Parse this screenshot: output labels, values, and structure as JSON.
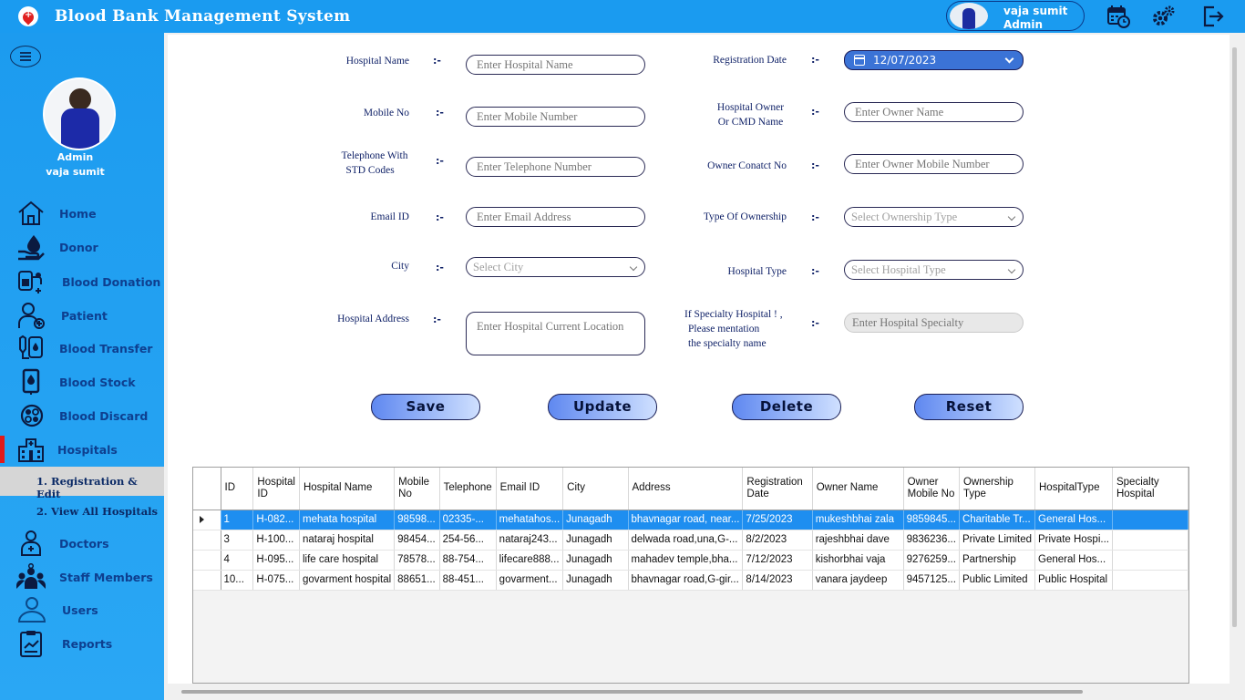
{
  "app": {
    "title": "Blood Bank Management System"
  },
  "header": {
    "user_name": "vaja sumit",
    "user_role": "Admin",
    "icons": [
      "calendar-clock-icon",
      "settings-gear-icon",
      "logout-icon"
    ]
  },
  "sidebar": {
    "profile_role": "Admin",
    "profile_name": "vaja sumit",
    "items": [
      {
        "label": "Home",
        "icon": "home-icon"
      },
      {
        "label": "Donor",
        "icon": "donor-icon"
      },
      {
        "label": "Blood Donation",
        "icon": "blood-donation-icon"
      },
      {
        "label": "Patient",
        "icon": "patient-icon"
      },
      {
        "label": "Blood Transfer",
        "icon": "blood-transfer-icon"
      },
      {
        "label": "Blood Stock",
        "icon": "blood-stock-icon"
      },
      {
        "label": "Blood Discard",
        "icon": "blood-discard-icon"
      },
      {
        "label": "Hospitals",
        "icon": "hospital-icon"
      },
      {
        "label": "Doctors",
        "icon": "doctor-icon"
      },
      {
        "label": "Staff Members",
        "icon": "staff-icon"
      },
      {
        "label": "Users",
        "icon": "users-icon"
      },
      {
        "label": "Reports",
        "icon": "reports-icon"
      }
    ],
    "sub_items": [
      {
        "label": "1.  Registration & Edit"
      },
      {
        "label": "2.  View All Hospitals"
      }
    ]
  },
  "form": {
    "colon": ":-",
    "hospital_name": {
      "label": "Hospital Name",
      "placeholder": "Enter Hospital Name"
    },
    "mobile_no": {
      "label": "Mobile No",
      "placeholder": "Enter Mobile Number"
    },
    "telephone": {
      "label_1": "Telephone With",
      "label_2": "STD Codes",
      "placeholder": "Enter Telephone Number"
    },
    "email": {
      "label": "Email ID",
      "placeholder": "Enter Email Address"
    },
    "city": {
      "label": "City",
      "placeholder": "Select City"
    },
    "address": {
      "label": "Hospital Address",
      "placeholder": "Enter Hospital Current Location"
    },
    "registration_date": {
      "label": "Registration Date",
      "value": "12/07/2023"
    },
    "owner_name": {
      "label_1": "Hospital Owner",
      "label_2": "Or CMD Name",
      "placeholder": "Enter Owner Name"
    },
    "owner_contact": {
      "label": "Owner Conatct No",
      "placeholder": "Enter Owner Mobile Number"
    },
    "ownership_type": {
      "label": "Type Of Ownership",
      "placeholder": "Select Ownership Type"
    },
    "hospital_type": {
      "label": "Hospital Type",
      "placeholder": "Select Hospital Type"
    },
    "specialty": {
      "label_1": "If Specialty Hospital ! ,",
      "label_2": "Please mentation",
      "label_3": "the specialty name",
      "placeholder": "Enter Hospital Specialty"
    }
  },
  "buttons": {
    "save": "Save",
    "update": "Update",
    "delete": "Delete",
    "reset": "Reset"
  },
  "table": {
    "columns": [
      "ID",
      "Hospital ID",
      "Hospital Name",
      "Mobile No",
      "Telephone",
      "Email ID",
      "City",
      "Address",
      "Registration Date",
      "Owner Name",
      "Owner Mobile No",
      "Ownership Type",
      "HospitalType",
      "Specialty Hospital"
    ],
    "rows": [
      [
        "1",
        "H-082...",
        "mehata hospital",
        "98598...",
        "02335-...",
        "mehatahos...",
        "Junagadh",
        "bhavnagar road, near...",
        "7/25/2023",
        "mukeshbhai zala",
        "9859845...",
        "Charitable Tr...",
        "General Hos...",
        ""
      ],
      [
        "3",
        "H-100...",
        "nataraj hospital",
        "98454...",
        "254-56...",
        "nataraj243...",
        "Junagadh",
        "delwada road,una,G-...",
        "8/2/2023",
        "rajeshbhai dave",
        "9836236...",
        "Private Limited",
        "Private Hospi...",
        ""
      ],
      [
        "4",
        "H-095...",
        "life care hospital",
        "78578...",
        "88-754...",
        "lifecare888...",
        "Junagadh",
        "mahadev temple,bha...",
        "7/12/2023",
        "kishorbhai vaja",
        "9276259...",
        "Partnership",
        "General Hos...",
        ""
      ],
      [
        "10...",
        "H-075...",
        "govarment hospital",
        "88651...",
        "88-451...",
        "govarment...",
        "Junagadh",
        "bhavnagar road,G-gir...",
        "8/14/2023",
        "vanara jaydeep",
        "9457125...",
        "Public Limited",
        "Public Hospital",
        ""
      ]
    ],
    "selected_row": 0
  }
}
